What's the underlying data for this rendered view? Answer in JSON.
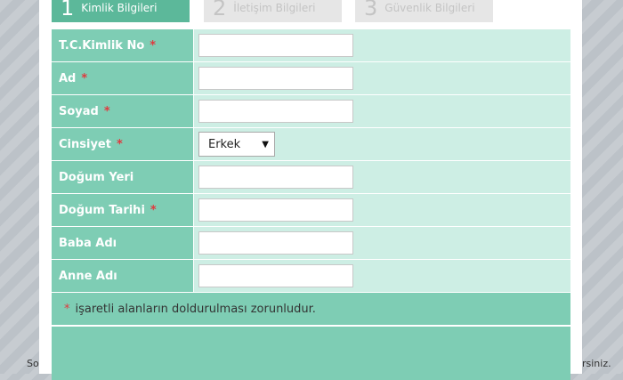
{
  "background": {
    "left_text": "So",
    "right_text": "rsiniz."
  },
  "steps": [
    {
      "num": "1",
      "label": "Kimlik Bilgileri",
      "active": true
    },
    {
      "num": "2",
      "label": "İletişim Bilgileri",
      "active": false
    },
    {
      "num": "3",
      "label": "Güvenlik Bilgileri",
      "active": false
    }
  ],
  "form": {
    "rows": [
      {
        "label": "T.C.Kimlik No",
        "required": "*",
        "value": ""
      },
      {
        "label": "Ad",
        "required": "*",
        "value": ""
      },
      {
        "label": "Soyad",
        "required": "*",
        "value": ""
      },
      {
        "label": "Cinsiyet",
        "required": "*",
        "select_value": "Erkek"
      },
      {
        "label": "Doğum Yeri",
        "required": "",
        "value": ""
      },
      {
        "label": "Doğum Tarihi",
        "required": "*",
        "value": ""
      },
      {
        "label": "Baba Adı",
        "required": "",
        "value": ""
      },
      {
        "label": "Anne Adı",
        "required": "",
        "value": ""
      }
    ],
    "note_star": "*",
    "note_text": "işaretli alanların doldurulması zorunludur."
  },
  "colors": {
    "label_bg": "#7ecdb4",
    "field_bg": "#cdeee4",
    "active_step": "#5cb89a",
    "required": "#e0393e"
  }
}
